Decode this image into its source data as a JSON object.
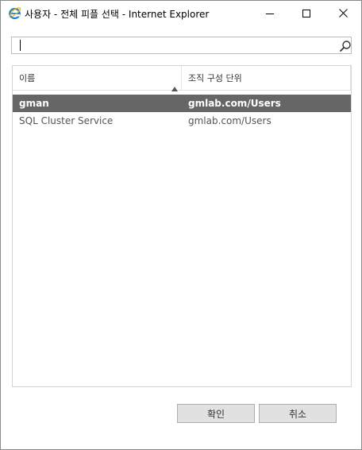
{
  "window": {
    "title": "사용자 - 전체 피플 선택 - Internet Explorer"
  },
  "search": {
    "value": "",
    "placeholder": ""
  },
  "table": {
    "columns": [
      "이름",
      "조직 구성 단위"
    ],
    "rows": [
      {
        "name": "gman",
        "ou": "gmlab.com/Users",
        "selected": true
      },
      {
        "name": "SQL Cluster Service",
        "ou": "gmlab.com/Users",
        "selected": false
      }
    ]
  },
  "buttons": {
    "ok_label": "확인",
    "cancel_label": "취소"
  },
  "colors": {
    "selected_row_bg": "#666666",
    "ie_blue": "#1e7fd8",
    "button_bg": "#e1e1e1"
  },
  "icons": {
    "app": "internet-explorer-icon",
    "search": "search-icon",
    "sort": "sort-ascending-icon"
  }
}
